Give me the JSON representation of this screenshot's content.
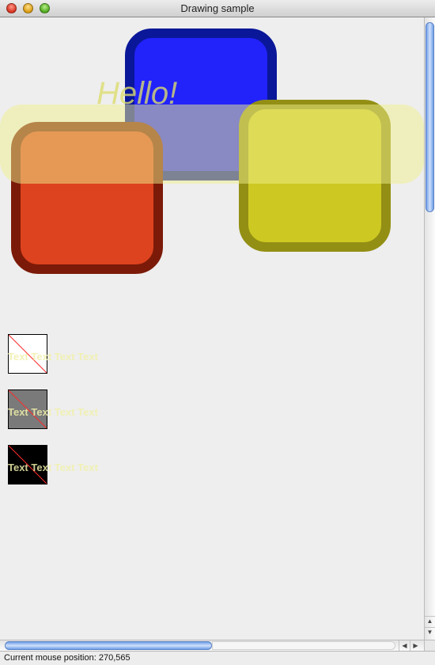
{
  "window": {
    "title": "Drawing sample"
  },
  "canvas": {
    "hello_text": "Hello!",
    "samples": [
      {
        "swatch": "white",
        "text": "Text Text Text Text"
      },
      {
        "swatch": "gray",
        "text": "Text Text Text Text"
      },
      {
        "swatch": "black",
        "text": "Text Text Text Text"
      }
    ],
    "colors": {
      "blue_fill": "#2222fa",
      "blue_border": "#0a1799",
      "orange_fill": "#dd431e",
      "orange_border": "#7b1a08",
      "yellow_fill": "#cdc922",
      "yellow_border": "#938f14"
    }
  },
  "statusbar": {
    "text": "Current mouse position: 270,565"
  },
  "icons": {
    "scroll_up": "▲",
    "scroll_down": "▼",
    "scroll_left": "◀",
    "scroll_right": "▶"
  }
}
